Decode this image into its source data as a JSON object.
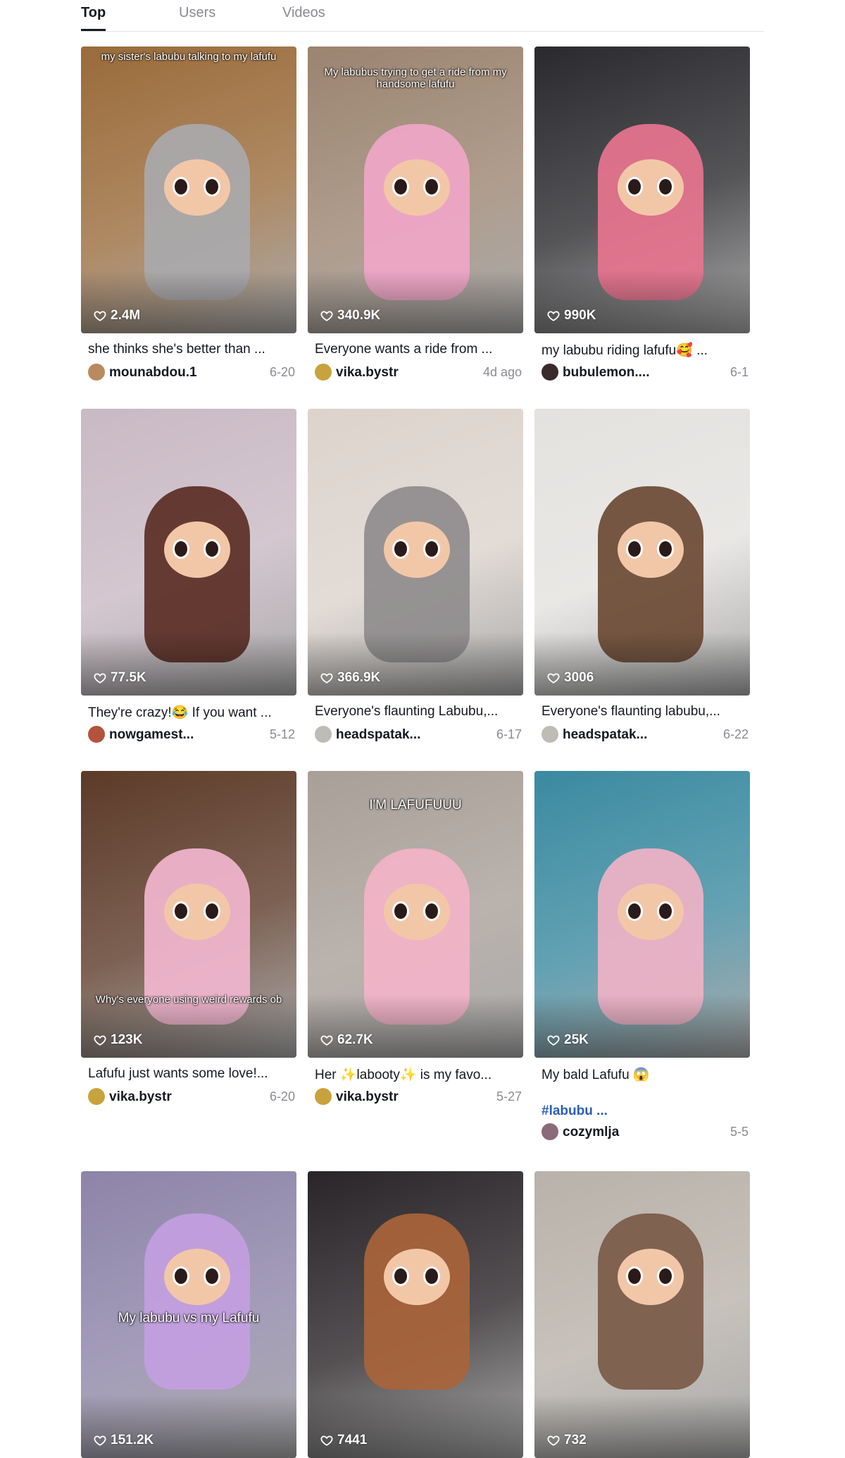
{
  "tabs": [
    {
      "label": "Top",
      "active": true
    },
    {
      "label": "Users",
      "active": false
    },
    {
      "label": "Videos",
      "active": false
    }
  ],
  "videos": [
    {
      "caption": "my sister's labubu talking to my lafufu",
      "likes": "2.4M",
      "title": "she thinks she's better than ...",
      "author": "mounabdou.1",
      "date": "6-20",
      "bg": "#9a6b3a",
      "fur": "#a9a9ad"
    },
    {
      "caption": "My labubus trying to get a ride from my handsome lafufu",
      "likes": "340.9K",
      "title": "Everyone wants a ride from ...",
      "author": "vika.bystr",
      "date": "4d ago",
      "bg": "#9b8470",
      "fur": "#f0a6c8"
    },
    {
      "caption": "",
      "likes": "990K",
      "title": "my labubu riding lafufu🥰 ...",
      "author": "bubulemon....",
      "date": "6-1",
      "bg": "#2a2a2e",
      "fur": "#e8748f"
    },
    {
      "caption": "",
      "likes": "77.5K",
      "title": "They're crazy!😂 If you want ...",
      "author": "nowgamest...",
      "date": "5-12",
      "bg": "#c9b9c4",
      "fur": "#5a2e25"
    },
    {
      "caption": "",
      "likes": "366.9K",
      "title": "Everyone's flaunting Labubu,...",
      "author": "headspatak...",
      "date": "6-17",
      "bg": "#dcd3cc",
      "fur": "#8f8c8d"
    },
    {
      "caption": "",
      "likes": "3006",
      "title": "Everyone's flaunting labubu,...",
      "author": "headspatak...",
      "date": "6-22",
      "bg": "#e4e2df",
      "fur": "#6a4a34"
    },
    {
      "caption": "Why's everyone using weird rewards ob",
      "likes": "123K",
      "title": "Lafufu just wants some love!...",
      "author": "vika.bystr",
      "date": "6-20",
      "bg": "#5c3a28",
      "fur": "#f2b6cf"
    },
    {
      "caption": "I'M LAFUFUUU",
      "likes": "62.7K",
      "title": "Her ✨labooty✨ is my favo...",
      "author": "vika.bystr",
      "date": "5-27",
      "bg": "#a99f98",
      "fur": "#f3b3c8"
    },
    {
      "caption": "",
      "likes": "25K",
      "title": "My bald Lafufu 😱",
      "hashtag": "#labubu ...",
      "author": "cozymlja",
      "date": "5-5",
      "bg": "#3b8aa0",
      "fur": "#f0b2c6"
    },
    {
      "caption": "My labubu vs my Lafufu",
      "likes": "151.2K",
      "title": "",
      "author": "",
      "date": "",
      "bg": "#8d84a8",
      "fur": "#c39ee0"
    },
    {
      "caption": "",
      "likes": "7441",
      "title": "",
      "author": "",
      "date": "",
      "bg": "#2a2528",
      "fur": "#a9643a"
    },
    {
      "caption": "",
      "likes": "732",
      "title": "",
      "author": "",
      "date": "",
      "bg": "#b9b2aa",
      "fur": "#7a5a46"
    }
  ]
}
